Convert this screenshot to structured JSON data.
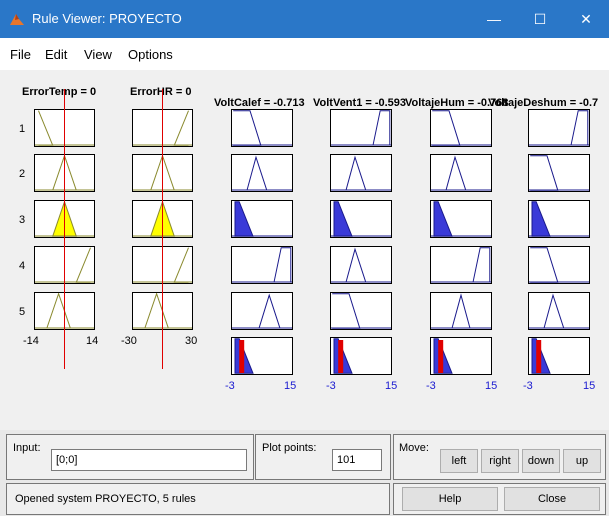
{
  "window": {
    "title": "Rule Viewer: PROYECTO",
    "minimize_glyph": "—",
    "maximize_glyph": "☐",
    "close_glyph": "✕"
  },
  "menu": [
    "File",
    "Edit",
    "View",
    "Options"
  ],
  "inputs": [
    {
      "name": "ErrorTemp = 0",
      "range_min": "-14",
      "range_max": "14"
    },
    {
      "name": "ErrorHR = 0",
      "range_min": "-30",
      "range_max": "30"
    }
  ],
  "outputs": [
    {
      "name": "VoltCalef = -0.713",
      "range_min": "-3",
      "range_max": "15"
    },
    {
      "name": "VoltVent1 = -0.593",
      "range_min": "-3",
      "range_max": "15"
    },
    {
      "name": "VoltajeHum = -0.768",
      "range_min": "-3",
      "range_max": "15"
    },
    {
      "name": "VoltajeDeshum = -0.7",
      "range_min": "-3",
      "range_max": "15"
    }
  ],
  "rules": [
    "1",
    "2",
    "3",
    "4",
    "5"
  ],
  "bottom": {
    "input_label": "Input:",
    "input_value": "[0;0]",
    "plot_points_label": "Plot points:",
    "plot_points_value": "101",
    "move_label": "Move:",
    "left": "left",
    "right": "right",
    "down": "down",
    "up": "up",
    "status": "Opened system PROYECTO, 5 rules",
    "help": "Help",
    "close": "Close"
  },
  "colors": {
    "title_bar": "#2a77c8",
    "input_mf": "#8a8a2e",
    "input_fill": "#ffff00",
    "output_mf": "#1a1a8c",
    "output_fill": "#3a3ad8",
    "crisp_line": "#e00000"
  }
}
